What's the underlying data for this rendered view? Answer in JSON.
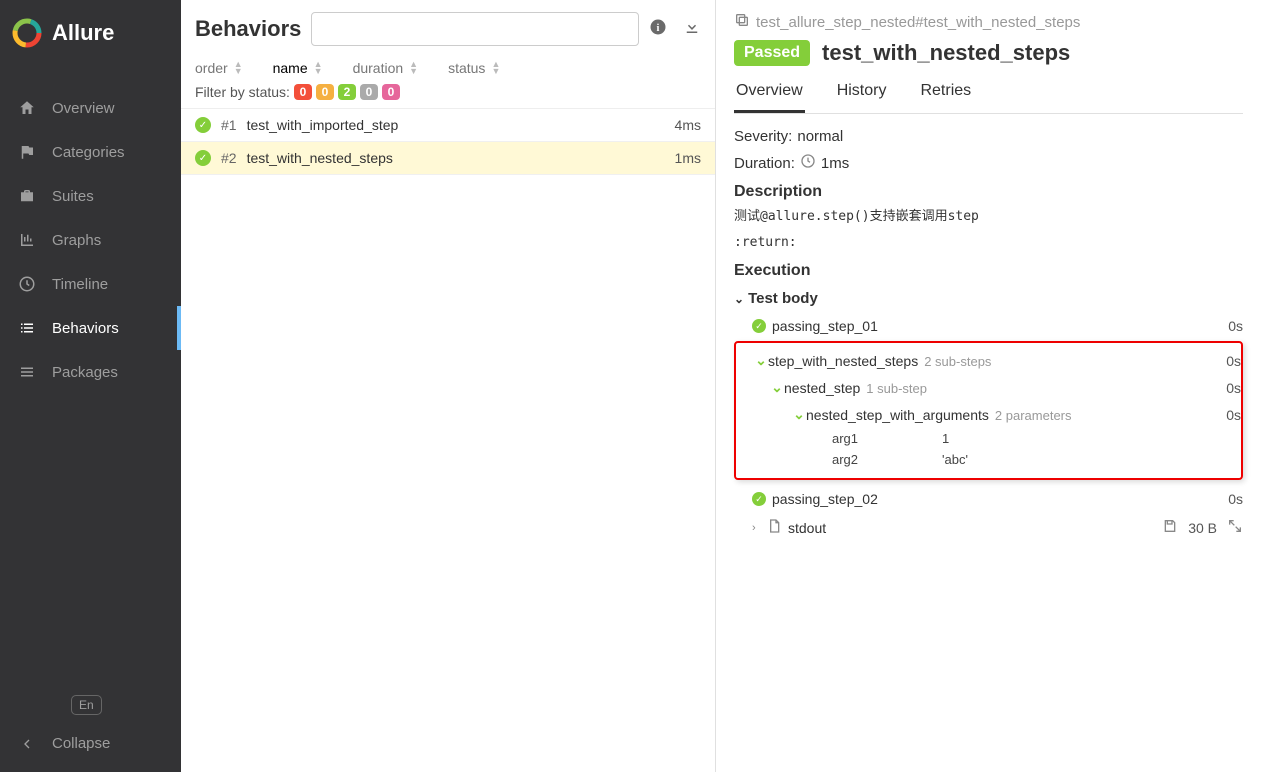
{
  "brand": "Allure",
  "nav": {
    "items": [
      {
        "label": "Overview"
      },
      {
        "label": "Categories"
      },
      {
        "label": "Suites"
      },
      {
        "label": "Graphs"
      },
      {
        "label": "Timeline"
      },
      {
        "label": "Behaviors"
      },
      {
        "label": "Packages"
      }
    ],
    "lang": "En",
    "collapse": "Collapse"
  },
  "mid": {
    "title": "Behaviors",
    "search_placeholder": "",
    "sorts": {
      "order": "order",
      "name": "name",
      "duration": "duration",
      "status": "status"
    },
    "filter_label": "Filter by status:",
    "filters": [
      "0",
      "0",
      "2",
      "0",
      "0"
    ],
    "rows": [
      {
        "num": "#1",
        "name": "test_with_imported_step",
        "dur": "4ms"
      },
      {
        "num": "#2",
        "name": "test_with_nested_steps",
        "dur": "1ms"
      }
    ]
  },
  "right": {
    "crumb": "test_allure_step_nested#test_with_nested_steps",
    "status": "Passed",
    "title": "test_with_nested_steps",
    "tabs": {
      "overview": "Overview",
      "history": "History",
      "retries": "Retries"
    },
    "severity_label": "Severity:",
    "severity_value": "normal",
    "duration_label": "Duration:",
    "duration_value": "1ms",
    "description_h": "Description",
    "description_line1": "测试@allure.step()支持嵌套调用step",
    "description_line2": ":return:",
    "execution_h": "Execution",
    "testbody_h": "Test body",
    "steps": {
      "s1": {
        "name": "passing_step_01",
        "dur": "0s"
      },
      "s2": {
        "name": "step_with_nested_steps",
        "sub": "2 sub-steps",
        "dur": "0s"
      },
      "s3": {
        "name": "nested_step",
        "sub": "1 sub-step",
        "dur": "0s"
      },
      "s4": {
        "name": "nested_step_with_arguments",
        "sub": "2 parameters",
        "dur": "0s"
      },
      "p1": {
        "k": "arg1",
        "v": "1"
      },
      "p2": {
        "k": "arg2",
        "v": "'abc'"
      },
      "s5": {
        "name": "passing_step_02",
        "dur": "0s"
      }
    },
    "attach": {
      "name": "stdout",
      "size": "30 B"
    }
  }
}
